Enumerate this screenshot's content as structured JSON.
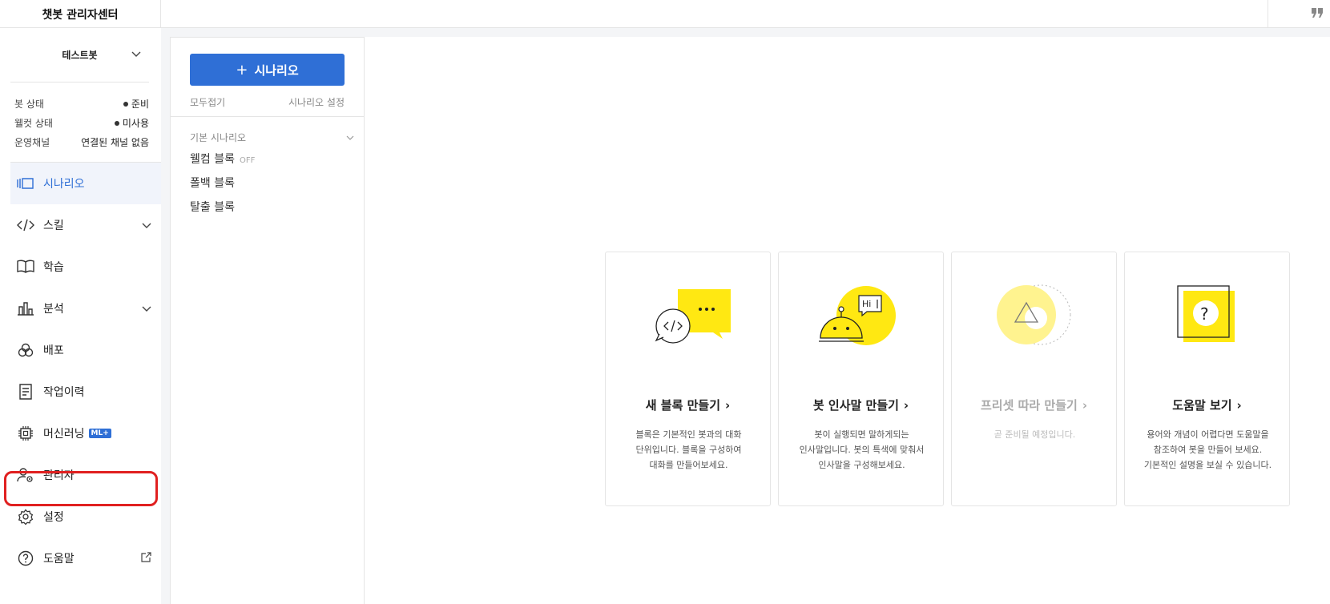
{
  "app": {
    "title": "챗봇 관리자센터"
  },
  "bot": {
    "name": "테스트봇"
  },
  "status": [
    {
      "label": "봇 상태",
      "value": "준비",
      "dot": true
    },
    {
      "label": "웰컷 상태",
      "value": "미사용",
      "dot": true
    },
    {
      "label": "운영채널",
      "value": "연결된 채널 없음",
      "dot": false
    }
  ],
  "nav": {
    "scenario": "시나리오",
    "skill": "스킬",
    "learn": "학습",
    "analysis": "분석",
    "deploy": "배포",
    "history": "작업이력",
    "ml": "머신러닝",
    "ml_badge": "ML+",
    "admin": "관리자",
    "settings": "설정",
    "help": "도움말"
  },
  "panel": {
    "add_button": "시나리오",
    "collapse_all": "모두접기",
    "scenario_settings": "시나리오 설정",
    "group_title": "기본 시나리오",
    "blocks": [
      {
        "label": "웰컴 블록",
        "tag": "OFF"
      },
      {
        "label": "폴백 블록",
        "tag": ""
      },
      {
        "label": "탈출 블록",
        "tag": ""
      }
    ]
  },
  "cards": [
    {
      "title": "새 블록 만들기",
      "desc1": "블록은 기본적인 봇과의 대화",
      "desc2": "단위입니다. 블록을 구성하여",
      "desc3": "대화를 만들어보세요."
    },
    {
      "title": "봇 인사말 만들기",
      "desc1": "봇이 실행되면 말하게되는",
      "desc2": "인사말입니다. 봇의 특색에 맞춰서",
      "desc3": "인사말을 구성해보세요.",
      "bubble": "Hi"
    },
    {
      "title": "프리셋 따라 만들기",
      "desc1": "곧 준비될 예정입니다.",
      "desc2": "",
      "desc3": ""
    },
    {
      "title": "도움말 보기",
      "desc1": "용어와 개념이 어렵다면 도움말을",
      "desc2": "참조하여 봇을 만들어 보세요.",
      "desc3": "기본적인 설명을 보실 수 있습니다.",
      "mark": "?"
    }
  ],
  "colors": {
    "accent": "#2f6fd6",
    "yellow": "#ffe812",
    "highlight": "#e02020"
  }
}
